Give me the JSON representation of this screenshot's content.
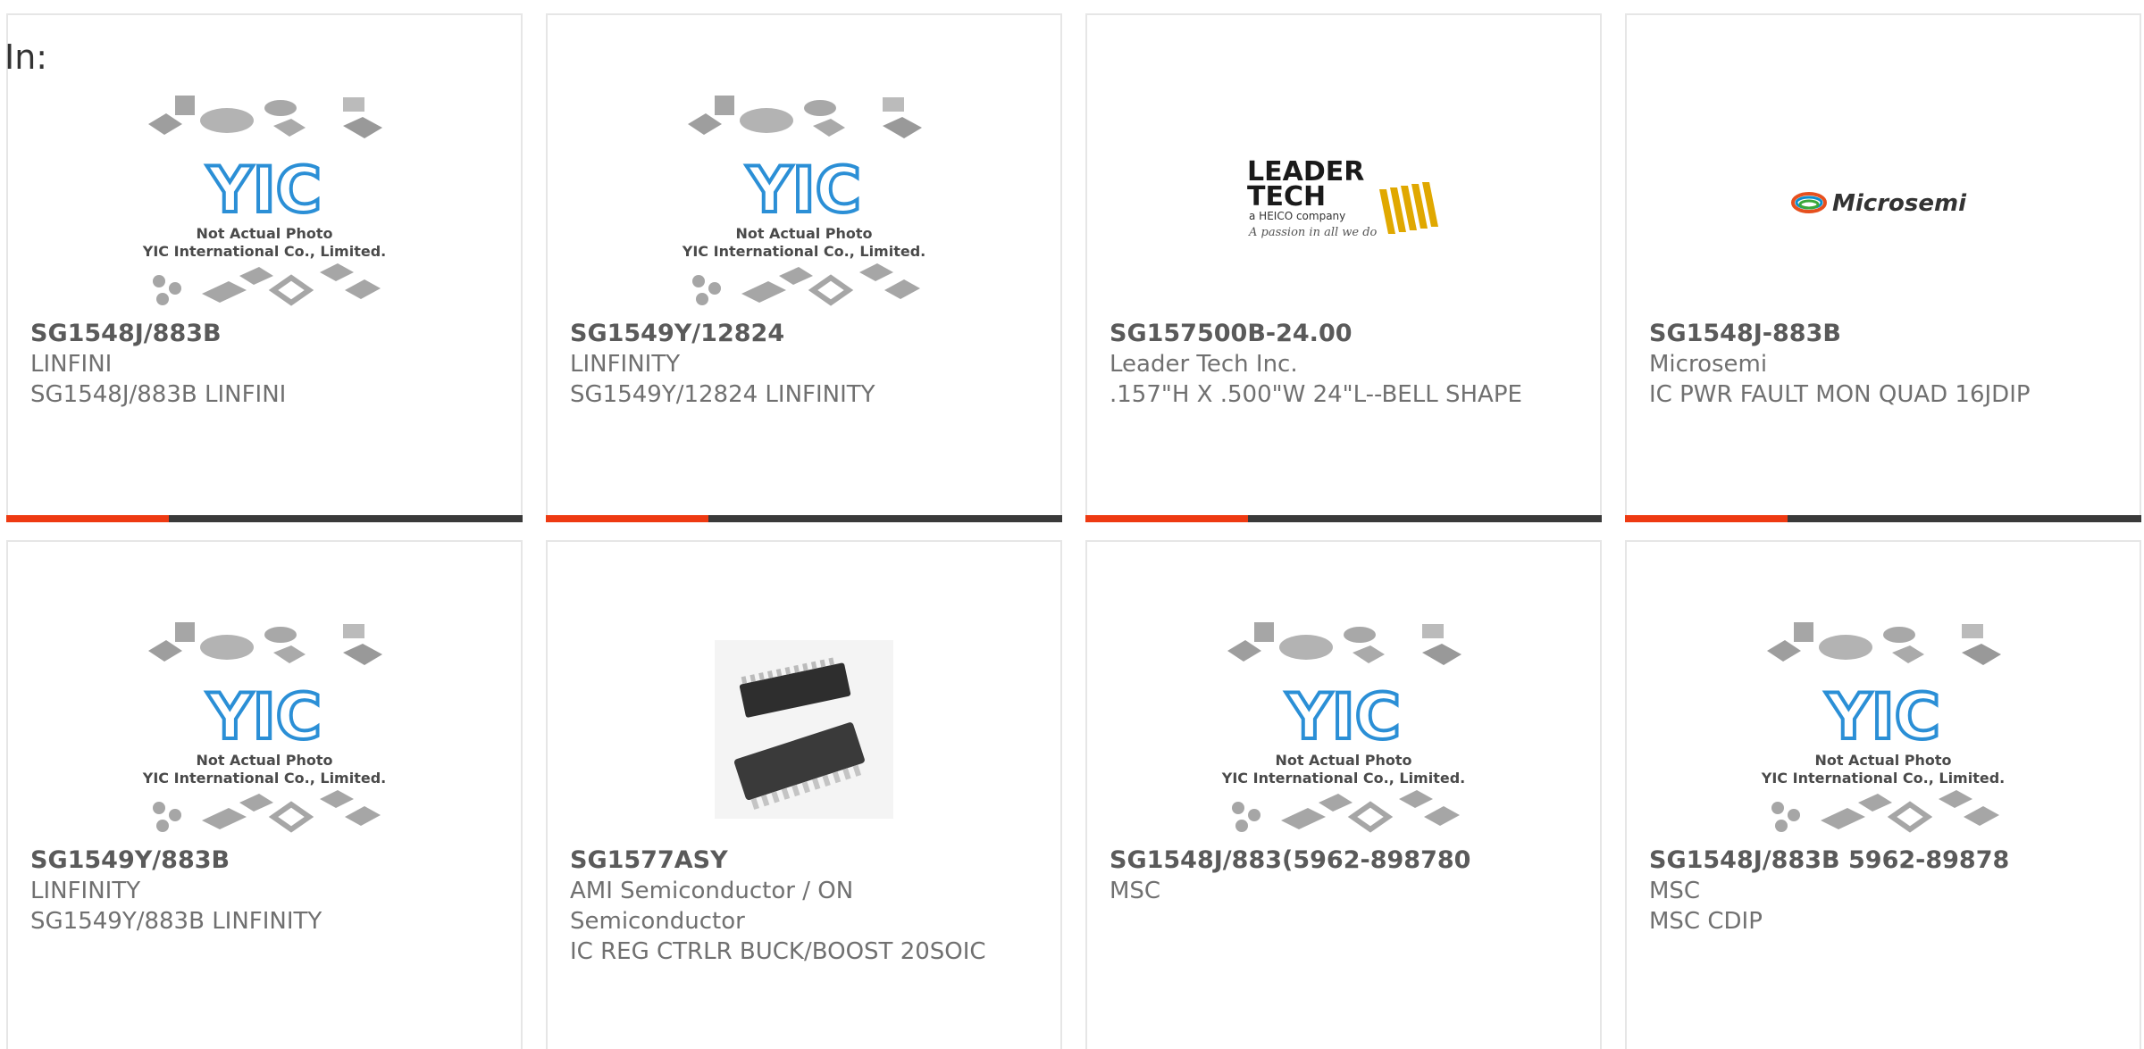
{
  "filter_label": "In:",
  "placeholder": {
    "line1": "Not Actual Photo",
    "line2": "YIC International Co., Limited.",
    "logo": "YIC"
  },
  "brand": {
    "accent": "#ee3a12",
    "bar": "#3a3a3a",
    "yic_blue": "#2b8fd6"
  },
  "products": [
    {
      "part": "SG1548J/883B",
      "maker": "LINFINI",
      "desc": "SG1548J/883B LINFINI",
      "image": "placeholder"
    },
    {
      "part": "SG1549Y/12824",
      "maker": "LINFINITY",
      "desc": "SG1549Y/12824 LINFINITY",
      "image": "placeholder"
    },
    {
      "part": "SG157500B-24.00",
      "maker": "Leader Tech Inc.",
      "desc": ".157\"H X .500\"W 24\"L--BELL SHAPE",
      "image": "leader-tech-logo",
      "logo_lines": [
        "LEADER",
        "TECH",
        "a HEICO company",
        "A passion in all we do"
      ]
    },
    {
      "part": "SG1548J-883B",
      "maker": "Microsemi",
      "desc": "IC PWR FAULT MON QUAD 16JDIP",
      "image": "microsemi-logo",
      "logo_text": "Microsemi"
    },
    {
      "part": "SG1549Y/883B",
      "maker": "LINFINITY",
      "desc": "SG1549Y/883B LINFINITY",
      "image": "placeholder"
    },
    {
      "part": "SG1577ASY",
      "maker": "AMI Semiconductor / ON Semiconductor",
      "desc": "IC REG CTRLR BUCK/BOOST 20SOIC",
      "image": "soic-chip-photo"
    },
    {
      "part": "SG1548J/883(5962-898780",
      "maker": "MSC",
      "desc": "",
      "image": "placeholder"
    },
    {
      "part": "SG1548J/883B 5962-89878",
      "maker": "MSC",
      "desc": "MSC CDIP",
      "image": "placeholder"
    }
  ]
}
